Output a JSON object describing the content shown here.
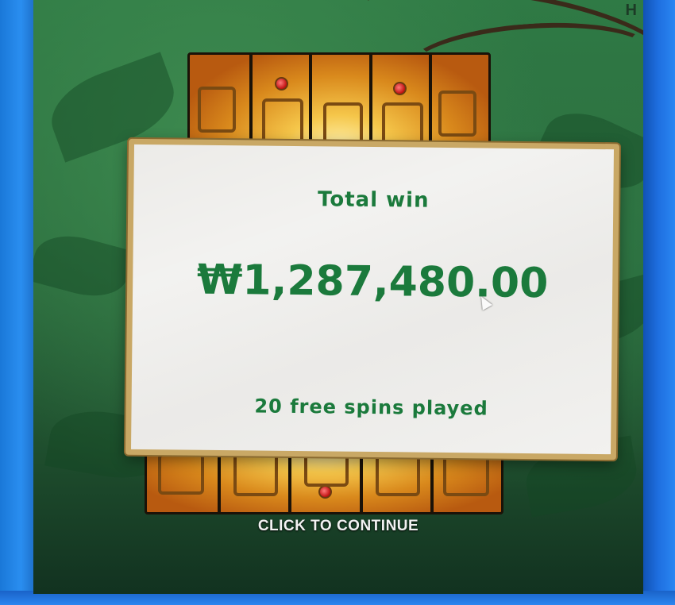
{
  "popup": {
    "title": "Total win",
    "amount": "₩1,287,480.00",
    "footer": "20 free spins played"
  },
  "continue_label": "CLICK TO CONTINUE",
  "corner_glyph": "H",
  "colors": {
    "accent_green": "#1b7a3c",
    "jungle_green": "#2f7a45",
    "gold": "#f5c64a",
    "parchment": "#ecebe8"
  }
}
